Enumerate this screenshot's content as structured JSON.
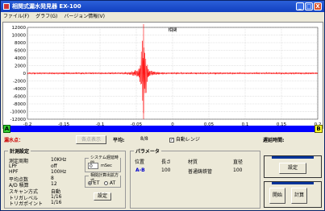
{
  "window": {
    "title": "相関式漏水発見器 EX-100",
    "btn_min": "_",
    "btn_max": "□",
    "btn_close": "X"
  },
  "menu": [
    "ファイル(F)",
    "グラフ(G)",
    "バージョン情報(V)"
  ],
  "chart_data": {
    "type": "line",
    "title": "相関",
    "x_ticks": [
      "-0.2",
      "-0.15",
      "-0.1",
      "-0.05",
      "0",
      "0.05",
      "0.1",
      "0.15",
      "0.2"
    ],
    "y_ticks": [
      "12000",
      "10000",
      "8000",
      "6000",
      "4000",
      "2000",
      "0",
      "-2000",
      "-4000",
      "-6000",
      "-8000",
      "-10000",
      "-12000"
    ],
    "xlim": [
      -0.2,
      0.2
    ],
    "ylim": [
      -12000,
      12000
    ],
    "grid": true,
    "series_color": "#ff0000",
    "peak_x": -0.04,
    "peak_y": 9000,
    "cursor_x": -0.04
  },
  "leak_point_label": "漏水点：",
  "point_btn": "各点表示",
  "avg_label": "平均:",
  "avg_value": "8/8",
  "auto_range_label": "自動レンジ",
  "auto_range_checked": "✓",
  "delay_label": "遅延時間:",
  "bar_a": "A",
  "bar_b": "B",
  "settings": {
    "title": "計測設定",
    "rows": [
      [
        "測定周期",
        "10KHz"
      ],
      [
        "LPF",
        "off"
      ],
      [
        "HPF",
        "100Hz"
      ],
      [
        "平均点数",
        "8"
      ],
      [
        "A/D 積算",
        "12"
      ],
      [
        "スキャン方式",
        "自動"
      ],
      [
        "トリガレベル",
        "1/16"
      ],
      [
        "トリガポイント",
        "1/16"
      ]
    ],
    "sys_delay_title": "システム遅延時間",
    "sys_delay_value": "0",
    "sys_delay_unit": "mSec",
    "corr_method_title": "相関計算出拡方式",
    "opt_et": "ET",
    "opt_at": "AT",
    "set_btn": "設定"
  },
  "params": {
    "title": "パラメータ",
    "headers": [
      "位置",
      "長さ",
      "材質",
      "直径"
    ],
    "row": [
      "A-B",
      "100",
      "普通鋳鉄管",
      "100"
    ]
  },
  "right": {
    "set_btn": "設定",
    "start_btn": "開始",
    "calc_btn": "計算"
  }
}
